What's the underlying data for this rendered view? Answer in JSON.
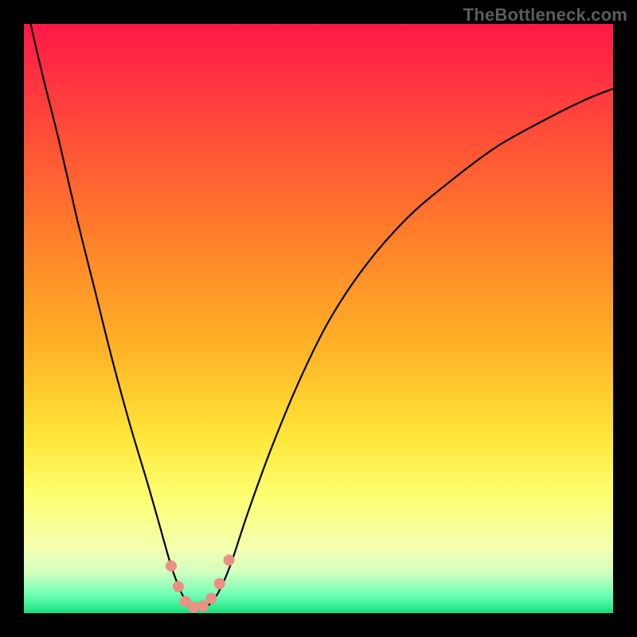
{
  "watermark": "TheBottleneck.com",
  "chart_data": {
    "type": "line",
    "title": "",
    "xlabel": "",
    "ylabel": "",
    "xlim": [
      0,
      100
    ],
    "ylim": [
      0,
      100
    ],
    "grid": false,
    "legend": false,
    "colors": {
      "gradient_stops": [
        {
          "pos": 0.0,
          "hex": "#ff1846"
        },
        {
          "pos": 0.12,
          "hex": "#ff3a3f"
        },
        {
          "pos": 0.35,
          "hex": "#ff7c2a"
        },
        {
          "pos": 0.55,
          "hex": "#ffb326"
        },
        {
          "pos": 0.7,
          "hex": "#ffe539"
        },
        {
          "pos": 0.8,
          "hex": "#fdff70"
        },
        {
          "pos": 0.89,
          "hex": "#f3ffb0"
        },
        {
          "pos": 0.93,
          "hex": "#d3ffc0"
        },
        {
          "pos": 0.97,
          "hex": "#6dffb4"
        },
        {
          "pos": 1.0,
          "hex": "#15e07e"
        }
      ],
      "curve": "#000000",
      "dots": "#ec8f85"
    },
    "series": [
      {
        "name": "bottleneck-curve",
        "x": [
          0,
          3,
          6,
          9,
          12,
          15,
          18,
          21,
          23,
          25,
          26.7,
          28,
          29,
          30,
          31.5,
          33,
          35,
          38,
          42,
          47,
          52,
          58,
          65,
          72,
          80,
          88,
          95,
          100
        ],
        "y": [
          105,
          92,
          80,
          67,
          55,
          43,
          32,
          22,
          15,
          8,
          3.5,
          1.5,
          0.8,
          0.8,
          1.5,
          3.5,
          8,
          17,
          28,
          40,
          50,
          59,
          67,
          73,
          79,
          83.5,
          87,
          89
        ]
      }
    ],
    "annotations": {
      "bottom_dots": [
        {
          "x": 25.0,
          "y": 8.0
        },
        {
          "x": 26.2,
          "y": 4.5
        },
        {
          "x": 27.4,
          "y": 2.0
        },
        {
          "x": 28.8,
          "y": 1.0
        },
        {
          "x": 30.4,
          "y": 1.2
        },
        {
          "x": 31.8,
          "y": 2.5
        },
        {
          "x": 33.2,
          "y": 5.0
        },
        {
          "x": 34.8,
          "y": 9.0
        }
      ]
    }
  }
}
